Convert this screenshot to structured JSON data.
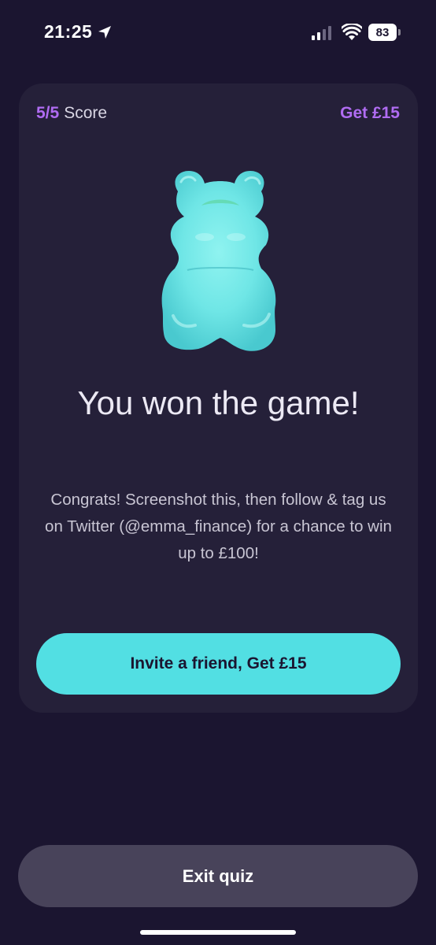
{
  "status_bar": {
    "time": "21:25",
    "battery": "83"
  },
  "card": {
    "score_value": "5/5",
    "score_label": "Score",
    "get_reward": "Get £15",
    "image": "gummy-bear",
    "title": "You won the game!",
    "message": "Congrats! Screenshot this, then follow & tag us on Twitter (@emma_finance) for a chance to win up to £100!",
    "invite_label": "Invite a friend, Get £15"
  },
  "exit_label": "Exit quiz",
  "colors": {
    "background": "#1b1530",
    "card": "#252039",
    "accent_purple": "#b06cf2",
    "accent_teal": "#52dfe3",
    "exit_button": "#48435a"
  }
}
